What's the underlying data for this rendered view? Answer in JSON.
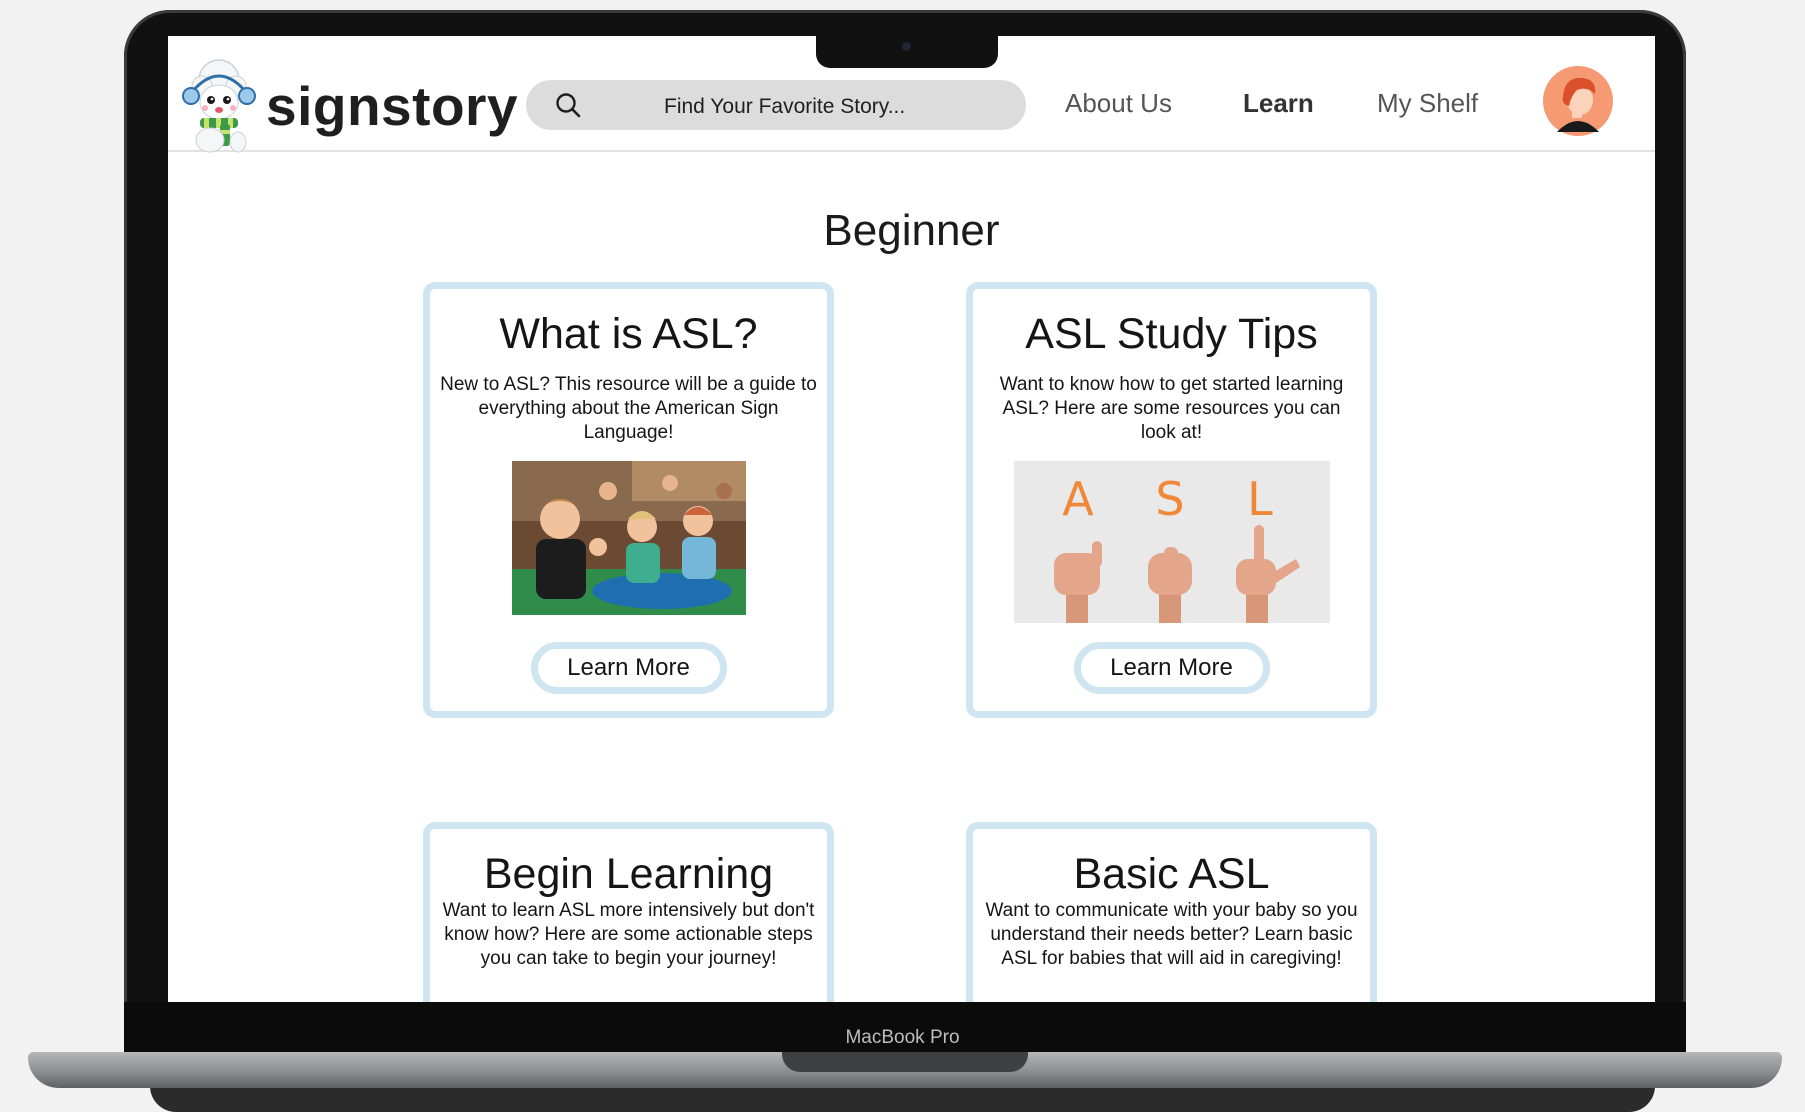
{
  "device": {
    "model_label": "MacBook Pro"
  },
  "header": {
    "logo_text": "signstory",
    "search": {
      "placeholder": "Find Your Favorite Story..."
    },
    "nav": [
      {
        "label": "About Us",
        "active": false
      },
      {
        "label": "Learn",
        "active": true
      },
      {
        "label": "My Shelf",
        "active": false
      }
    ],
    "avatar_icon": "user-avatar-icon"
  },
  "main": {
    "section_title": "Beginner",
    "cards": [
      {
        "title": "What is ASL?",
        "description": "New to ASL? This resource will be a guide to everything about the American Sign Language!",
        "image": "children-signing-photo",
        "button_label": "Learn More"
      },
      {
        "title": "ASL Study Tips",
        "description": "Want to know how to get started learning ASL? Here are some resources you can look at!",
        "image": "asl-letters-hands-image",
        "image_letters": [
          "A",
          "S",
          "L"
        ],
        "button_label": "Learn More"
      },
      {
        "title": "Begin Learning",
        "description": "Want to learn ASL more intensively but don't know how? Here are some actionable steps you can take to begin your journey!"
      },
      {
        "title": "Basic ASL",
        "description": "Want to communicate with your baby so you understand their needs better? Learn basic ASL for babies that will aid in caregiving!"
      }
    ]
  },
  "colors": {
    "card_border": "#cfe6f2",
    "search_bg": "#dcdcdc",
    "asl_letter": "#f0883a"
  }
}
